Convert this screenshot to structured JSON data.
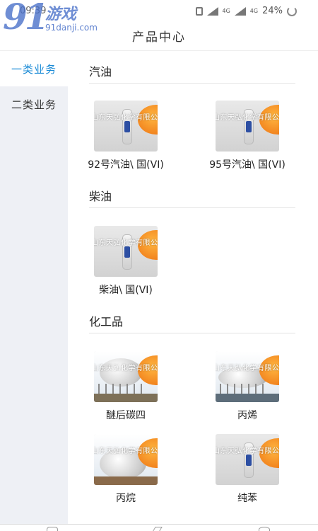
{
  "status_bar": {
    "time": "09:39",
    "network_1": "4G",
    "network_2": "4G",
    "battery": "24%"
  },
  "watermark": {
    "number": "91",
    "site_name": "游戏",
    "url": "91danji.com"
  },
  "header": {
    "title": "产品中心"
  },
  "sidebar": {
    "items": [
      {
        "label": "一类业务",
        "active": true
      },
      {
        "label": "二类业务",
        "active": false
      }
    ]
  },
  "image_watermark": "山东天弘化学有限公司",
  "sections": [
    {
      "title": "汽油",
      "products": [
        {
          "name": "92号汽油\\ 国(VI)",
          "image": "bottle"
        },
        {
          "name": "95号汽油\\ 国(VI)",
          "image": "bottle"
        }
      ]
    },
    {
      "title": "柴油",
      "products": [
        {
          "name": "柴油\\ 国(VI)",
          "image": "bottle"
        }
      ]
    },
    {
      "title": "化工品",
      "products": [
        {
          "name": "醚后碳四",
          "image": "spherical-tank"
        },
        {
          "name": "丙烯",
          "image": "spherical-tank"
        },
        {
          "name": "丙烷",
          "image": "spherical-tank"
        },
        {
          "name": "纯苯",
          "image": "bottle"
        }
      ]
    }
  ],
  "colors": {
    "accent": "#1b8bd6",
    "sidebar_bg": "#eef0f5",
    "badge": "#f07d1a"
  },
  "icons": [
    "signal-icon",
    "vibrate-icon",
    "battery-icon",
    "nav-home-icon",
    "nav-back-icon",
    "nav-recent-icon"
  ]
}
